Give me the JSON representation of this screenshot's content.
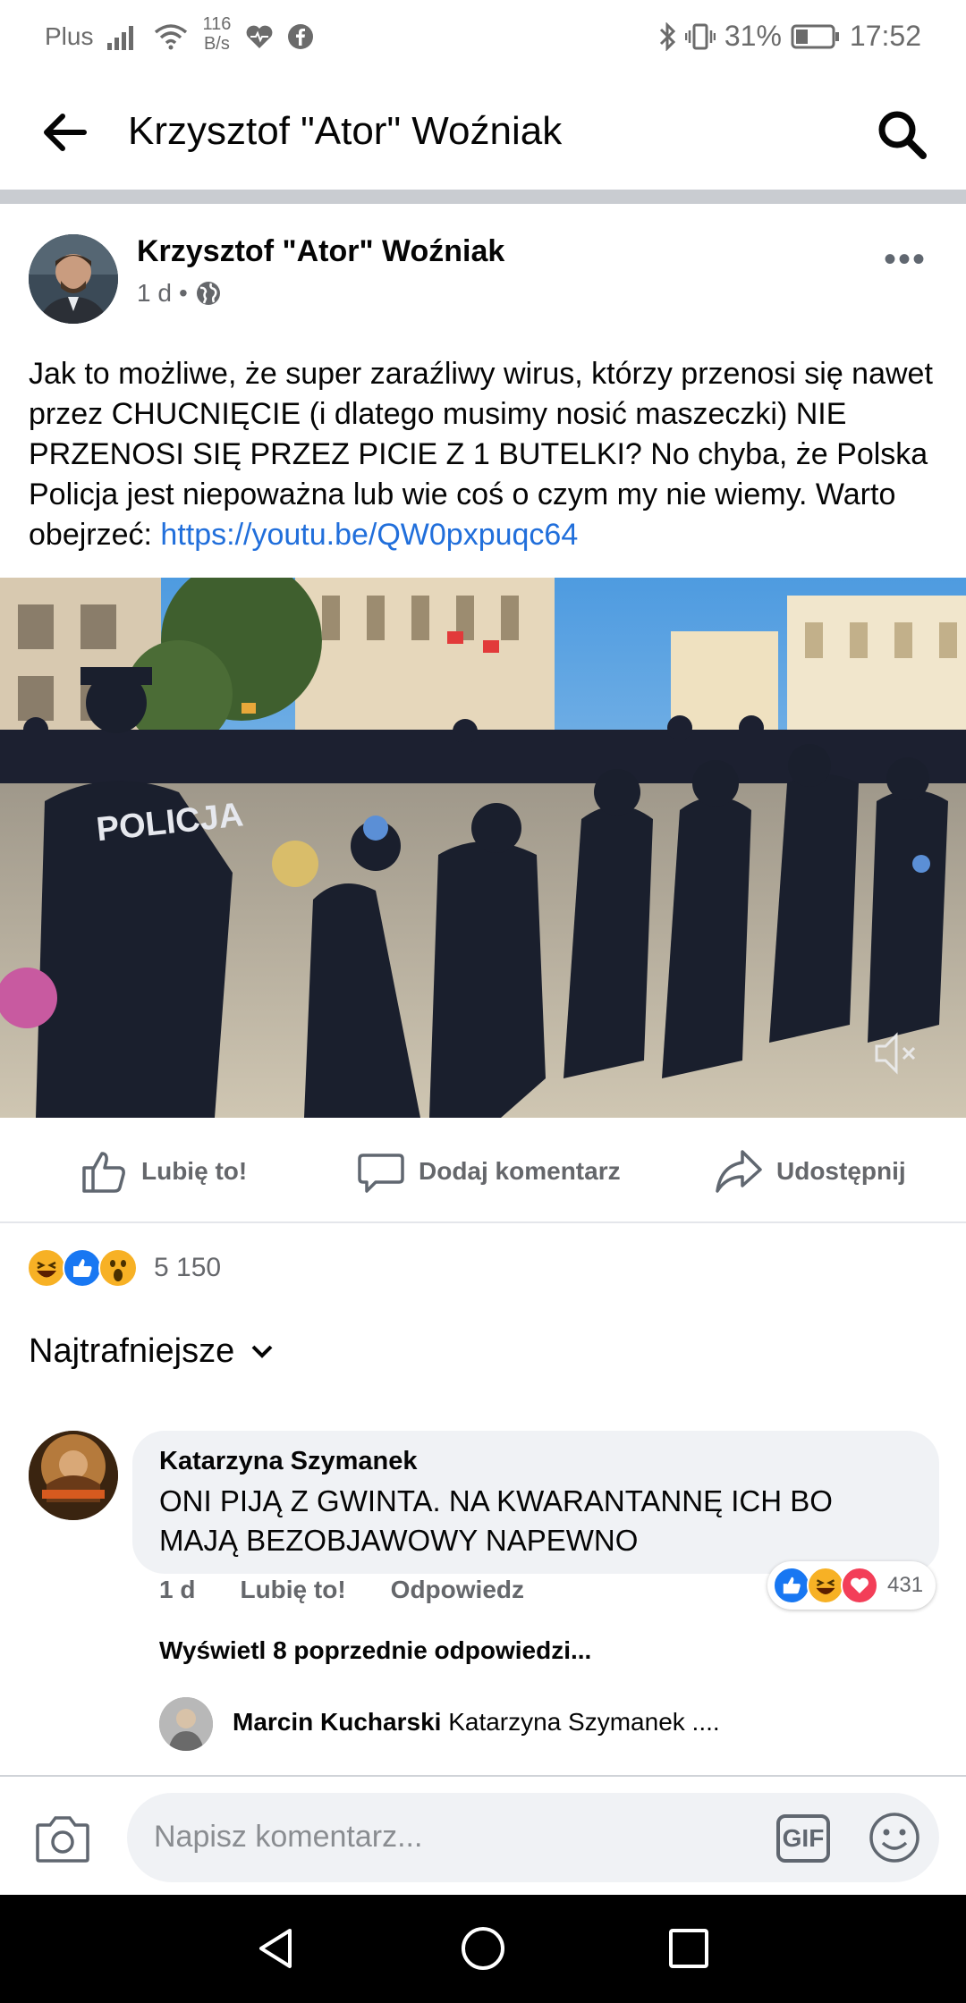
{
  "status_bar": {
    "carrier": "Plus",
    "speed_value": "116",
    "speed_unit": "B/s",
    "battery": "31%",
    "time": "17:52"
  },
  "app_bar": {
    "title": "Krzysztof \"Ator\" Woźniak"
  },
  "post": {
    "author": "Krzysztof \"Ator\" Woźniak",
    "time": "1 d",
    "separator": "•",
    "text": "Jak to możliwe, że super zaraźliwy wirus, którzy przenosi się nawet przez CHUCNIĘCIE (i dlatego musimy nosić maszeczki) NIE PRZENOSI SIĘ PRZEZ PICIE Z 1 BUTELKI? No chyba, że Polska Policja jest niepoważna lub wie coś o czym my nie wiemy. Warto obejrzeć: ",
    "link": "https://youtu.be/QW0pxpuqc64",
    "video_text": "POLICJA"
  },
  "actions": {
    "like": "Lubię to!",
    "comment": "Dodaj komentarz",
    "share": "Udostępnij"
  },
  "reactions": {
    "count": "5 150"
  },
  "sort": {
    "label": "Najtrafniejsze"
  },
  "comment": {
    "author": "Katarzyna Szymanek",
    "text": "ONI PIJĄ Z GWINTA. NA KWARANTANNĘ ICH BO MAJĄ BEZOBJAWOWY NAPEWNO",
    "time": "1 d",
    "like": "Lubię to!",
    "reply": "Odpowiedz",
    "reaction_count": "431"
  },
  "replies": {
    "view_more": "Wyświetl 8 poprzednie odpowiedzi...",
    "reply_author": "Marcin Kucharski",
    "reply_preview": "Katarzyna Szymanek ...."
  },
  "composer": {
    "placeholder": "Napisz komentarz...",
    "gif_label": "GIF"
  },
  "colors": {
    "link": "#216fdb",
    "like_blue": "#1877f2",
    "love_red": "#f33e58",
    "haha_yellow": "#f7b125"
  }
}
